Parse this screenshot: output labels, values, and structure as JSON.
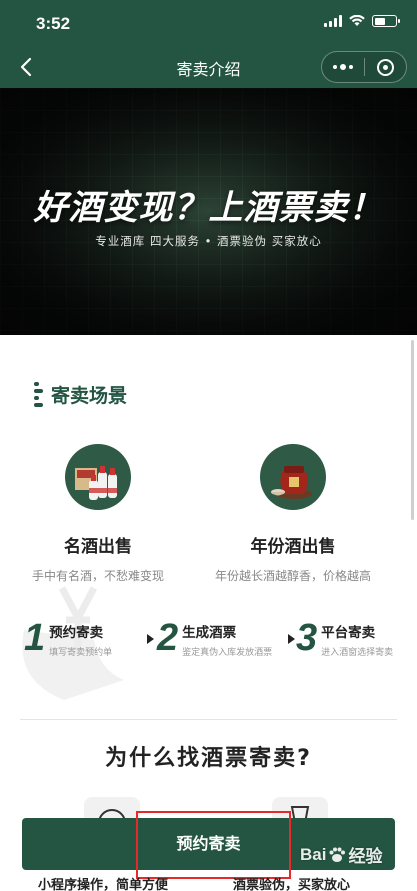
{
  "status_bar": {
    "time": "3:52"
  },
  "nav": {
    "title": "寄卖介绍"
  },
  "banner": {
    "headline": "好酒变现？上酒票卖！",
    "subline": "专业酒库  四大服务  •  酒票验伪  买家放心"
  },
  "section": {
    "title": "寄卖场景"
  },
  "features": [
    {
      "title": "名酒出售",
      "desc": "手中有名酒，不愁难变现",
      "icon": "liquor-bottles-icon"
    },
    {
      "title": "年份酒出售",
      "desc": "年份越长酒越醇香，价格越高",
      "icon": "wine-jar-icon"
    }
  ],
  "steps": [
    {
      "num": "1",
      "title": "预约寄卖",
      "desc": "填写寄卖预约单"
    },
    {
      "num": "2",
      "title": "生成酒票",
      "desc": "鉴定真伪入库发放酒票"
    },
    {
      "num": "3",
      "title": "平台寄卖",
      "desc": "进入酒窗选择寄卖"
    }
  ],
  "why": {
    "title": "为什么找酒票寄卖?"
  },
  "cta": {
    "label": "预约寄卖"
  },
  "benefits": {
    "left": "小程序操作，简单方便",
    "right": "酒票验伪，买家放心"
  },
  "watermark": {
    "text": "Bai",
    "suffix": "经验"
  },
  "colors": {
    "primary": "#245543",
    "highlight": "#e52a2a"
  }
}
